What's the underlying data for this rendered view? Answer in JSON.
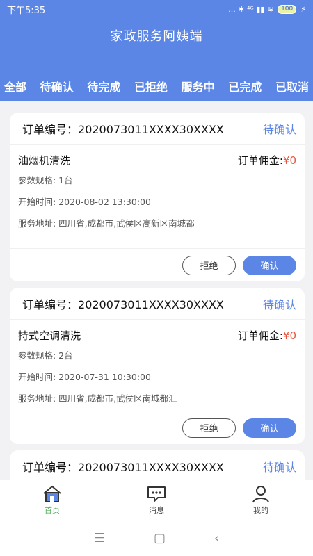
{
  "status_bar": {
    "time": "下午5:35",
    "icons": "... ✱ ⁴ᴳ ▮▮ ≋",
    "battery": "100"
  },
  "header": {
    "title": "家政服务阿姨端"
  },
  "tabs": [
    "全部",
    "待确认",
    "待完成",
    "已拒绝",
    "服务中",
    "已完成",
    "已取消"
  ],
  "orders": [
    {
      "order_label": "订单编号：",
      "order_no": "2020073011XXXX30XXXX",
      "status": "待确认",
      "service": "油烟机清洗",
      "fee_label": "订单佣金:",
      "fee_value": "¥0",
      "spec": "参数规格: 1台",
      "start": "开始时间: 2020-08-02 13:30:00",
      "address": "服务地址: 四川省,成都市,武侯区高新区南城都",
      "reject": "拒绝",
      "confirm": "确认"
    },
    {
      "order_label": "订单编号：",
      "order_no": "2020073011XXXX30XXXX",
      "status": "待确认",
      "service": "持式空调清洗",
      "fee_label": "订单佣金:",
      "fee_value": "¥0",
      "spec": "参数规格: 2台",
      "start": "开始时间: 2020-07-31 10:30:00",
      "address": "服务地址: 四川省,成都市,武侯区南城都汇",
      "reject": "拒绝",
      "confirm": "确认"
    },
    {
      "order_label": "订单编号：",
      "order_no": "2020073011XXXX30XXXX",
      "status": "待确认"
    }
  ],
  "bottom_nav": [
    {
      "label": "首页",
      "icon": "home-icon",
      "active": true
    },
    {
      "label": "消息",
      "icon": "message-icon",
      "active": false
    },
    {
      "label": "我的",
      "icon": "user-icon",
      "active": false
    }
  ],
  "colors": {
    "accent": "#5b86e5",
    "price": "#e8553e",
    "active_nav": "#4caf50"
  }
}
